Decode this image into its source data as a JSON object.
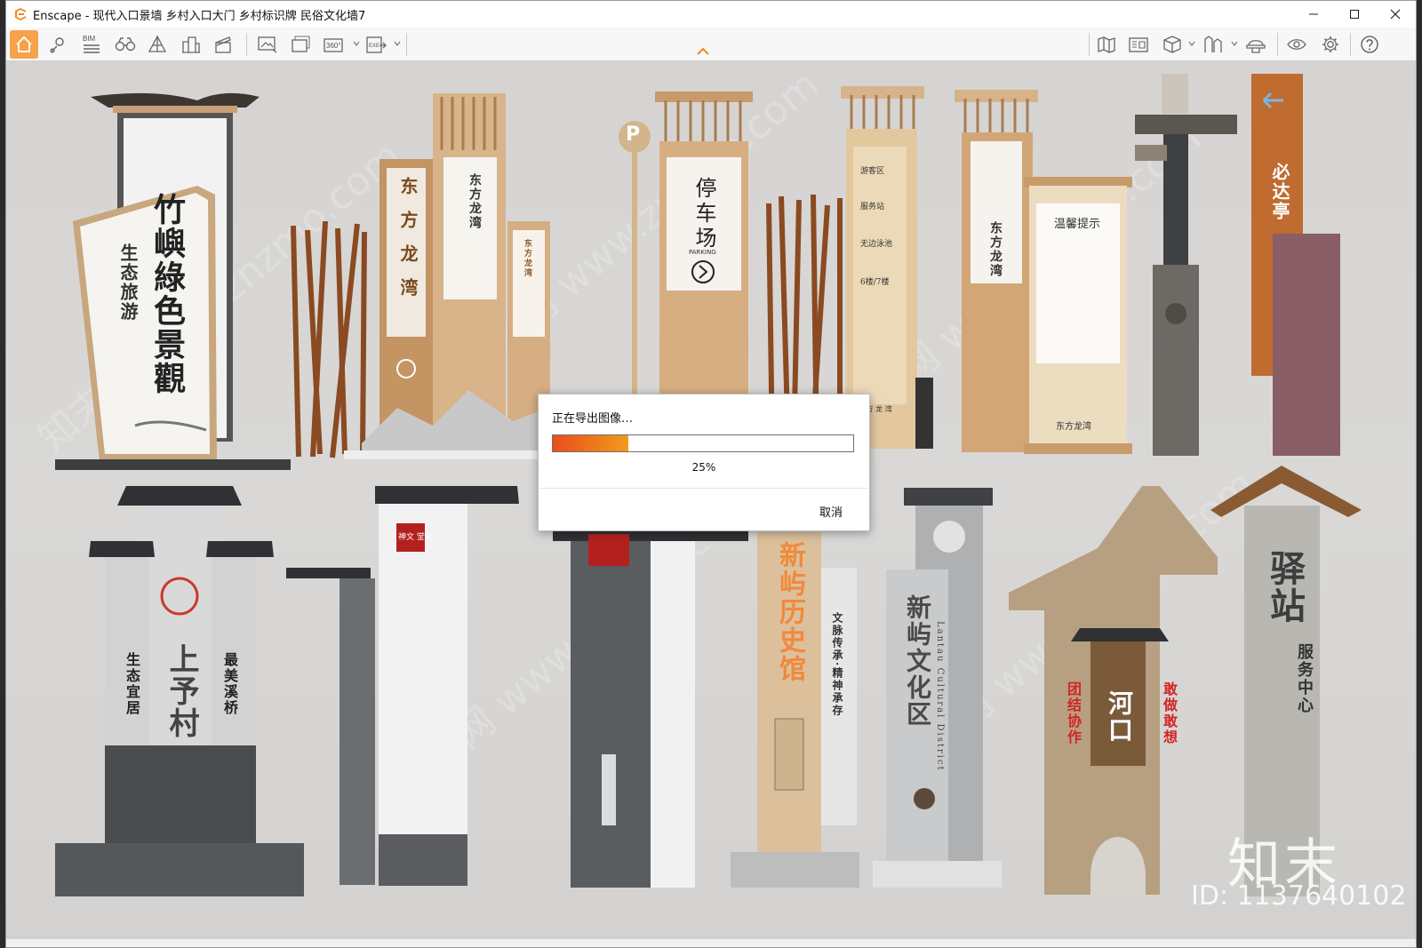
{
  "window": {
    "title": "Enscape - 现代入口景墙 乡村入口大门 乡村标识牌 民俗文化墙7",
    "controls": [
      "minimize-icon",
      "maximize-icon",
      "close-icon"
    ]
  },
  "toolbar": {
    "bim_label": "BIM",
    "left_icons": [
      "home-icon",
      "location-pin-icon",
      "bim-icon",
      "binoculars-icon",
      "perspective-icon",
      "buildings-icon",
      "clapboard-icon",
      "screenshot-icon",
      "batch-render-icon",
      "panorama-360-icon",
      "exe-export-icon"
    ],
    "pano_label": "360°",
    "exe_label": "EXE",
    "right_icons": [
      "map-icon",
      "asset-library-icon",
      "cube-view-icon",
      "materials-icon",
      "hat-icon",
      "eye-icon",
      "settings-icon",
      "help-icon"
    ],
    "collapse_icon": "chevron-up-icon",
    "accent_color": "#f6a24a"
  },
  "scene": {
    "sign1": {
      "top": "竹嶼綠色景觀",
      "side": "生态旅游"
    },
    "sign2": {
      "chars": "东方龙湾",
      "panel": "东方龙湾",
      "panel2": "东方龙湾"
    },
    "sign3": {
      "letter": "P",
      "chars": "停车场",
      "sub": "PARKING"
    },
    "sign4": {
      "line1": "游客区",
      "line2": "服务站",
      "line3": "无边泳池",
      "line4": "6楼/7楼",
      "footer": "东 方 龙 湾"
    },
    "sign5": {
      "chars": "东方龙湾",
      "banner_title": "温馨提示",
      "banner_footer": "东方龙湾"
    },
    "sign6": {
      "chars": "必达亭"
    },
    "sign7": {
      "main": "上予村",
      "left": "生态宜居",
      "right": "最美溪桥"
    },
    "sign8": {
      "seal": "神文 堂化"
    },
    "sign9": {
      "main": "新屿历史馆",
      "side": "文脉传承·精神承存"
    },
    "sign10": {
      "main": "新屿文化区",
      "en": "Lantau Cultural District"
    },
    "sign11": {
      "main": "河口",
      "left": "团结协作",
      "right": "敢做敢想"
    },
    "sign12": {
      "main": "驿站",
      "sub": "服务中心"
    },
    "watermark_brand": "知末",
    "watermark_id": "ID: 1137640102",
    "diagonal_watermark": "知末网 www.znzmo.com"
  },
  "export_dialog": {
    "title": "正在导出图像…",
    "progress_percent": 25,
    "progress_text": "25%",
    "cancel_label": "取消"
  }
}
